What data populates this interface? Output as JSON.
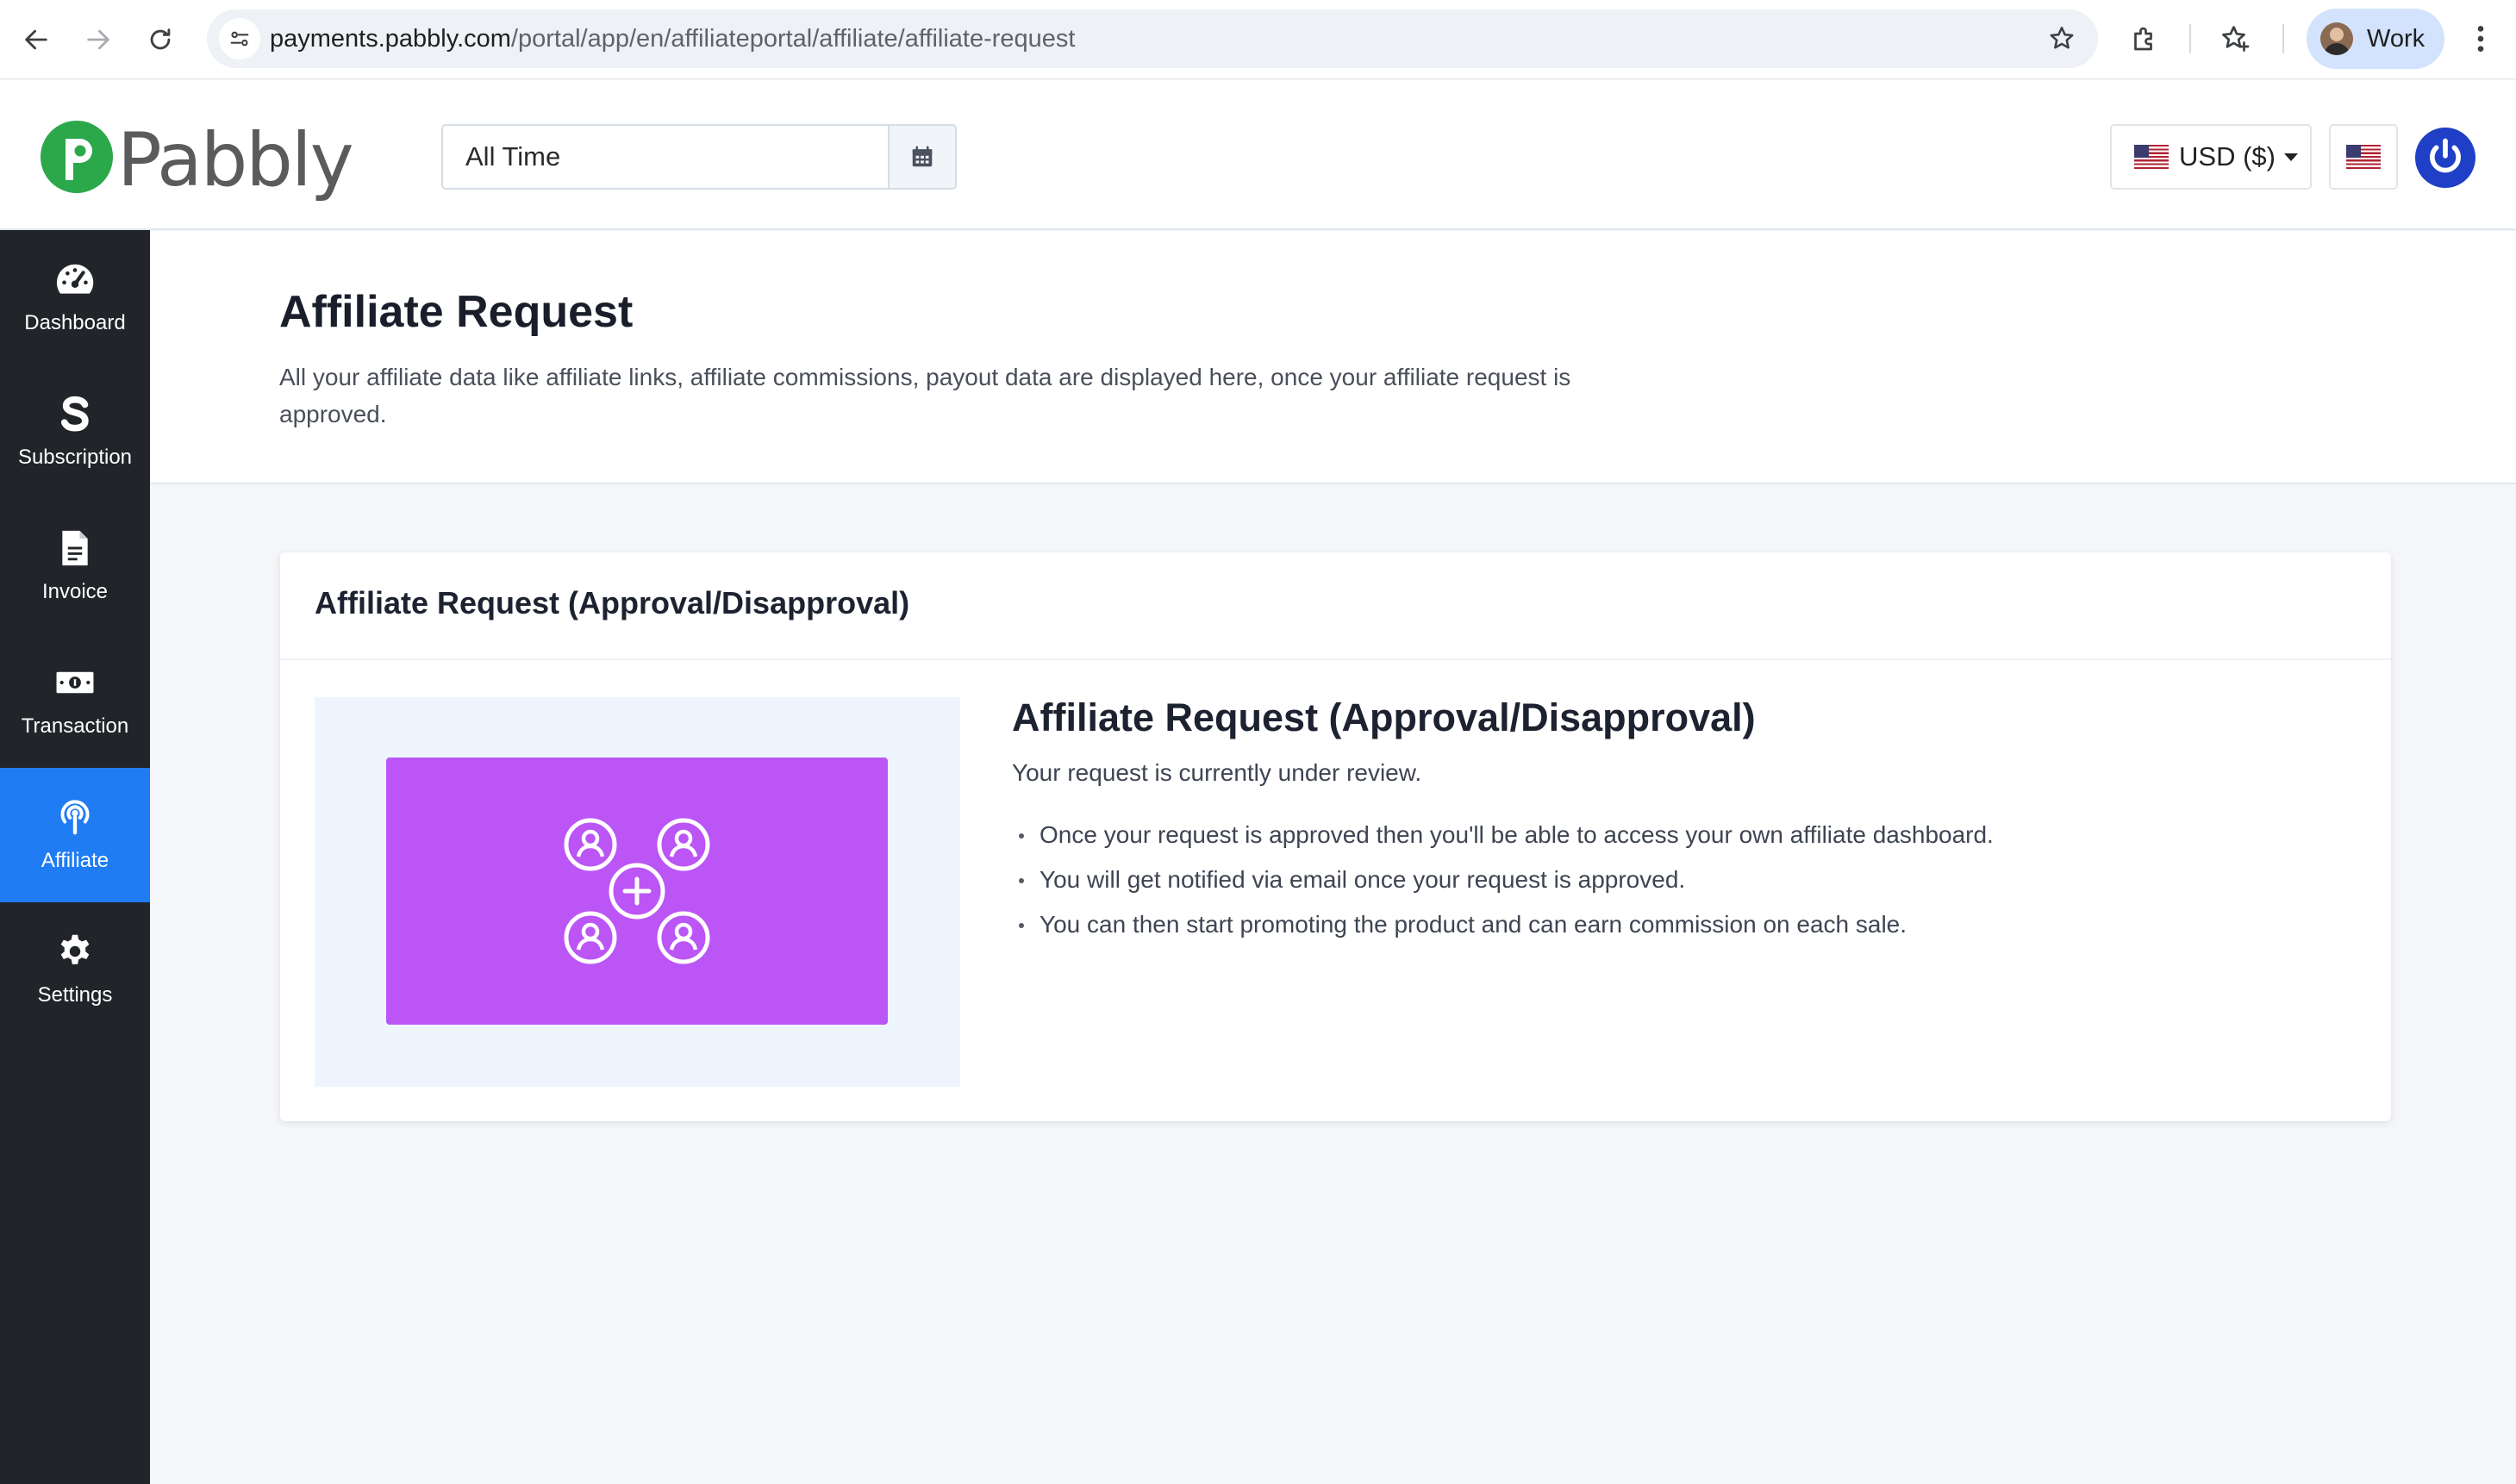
{
  "browser": {
    "url_host": "payments.pabbly.com",
    "url_path": "/portal/app/en/affiliateportal/affiliate/affiliate-request",
    "profile_name": "Work"
  },
  "header": {
    "logo_text": "Pabbly",
    "date_range_value": "All Time",
    "currency_label": "USD ($)",
    "brand_color": "#2ba84a",
    "power_color": "#1f3fc6"
  },
  "sidebar": {
    "items": [
      {
        "label": "Dashboard",
        "icon": "speedometer-icon",
        "active": false
      },
      {
        "label": "Subscription",
        "icon": "s-letter-icon",
        "active": false
      },
      {
        "label": "Invoice",
        "icon": "document-icon",
        "active": false
      },
      {
        "label": "Transaction",
        "icon": "cash-icon",
        "active": false
      },
      {
        "label": "Affiliate",
        "icon": "broadcast-icon",
        "active": true
      },
      {
        "label": "Settings",
        "icon": "gear-icon",
        "active": false
      }
    ],
    "active_color": "#1f7cf2"
  },
  "page": {
    "title": "Affiliate Request",
    "description": "All your affiliate data like affiliate links, affiliate commissions, payout data are displayed here, once your affiliate request is approved."
  },
  "card": {
    "header_title": "Affiliate Request (Approval/Disapproval)",
    "heading": "Affiliate Request (Approval/Disapproval)",
    "status": "Your request is currently under review.",
    "points": [
      "Once your request is approved then you'll be able to access your own affiliate dashboard.",
      "You will get notified via email once your request is approved.",
      "You can then start promoting the product and can earn commission on each sale."
    ],
    "illustration_color": "#bb55f5"
  }
}
